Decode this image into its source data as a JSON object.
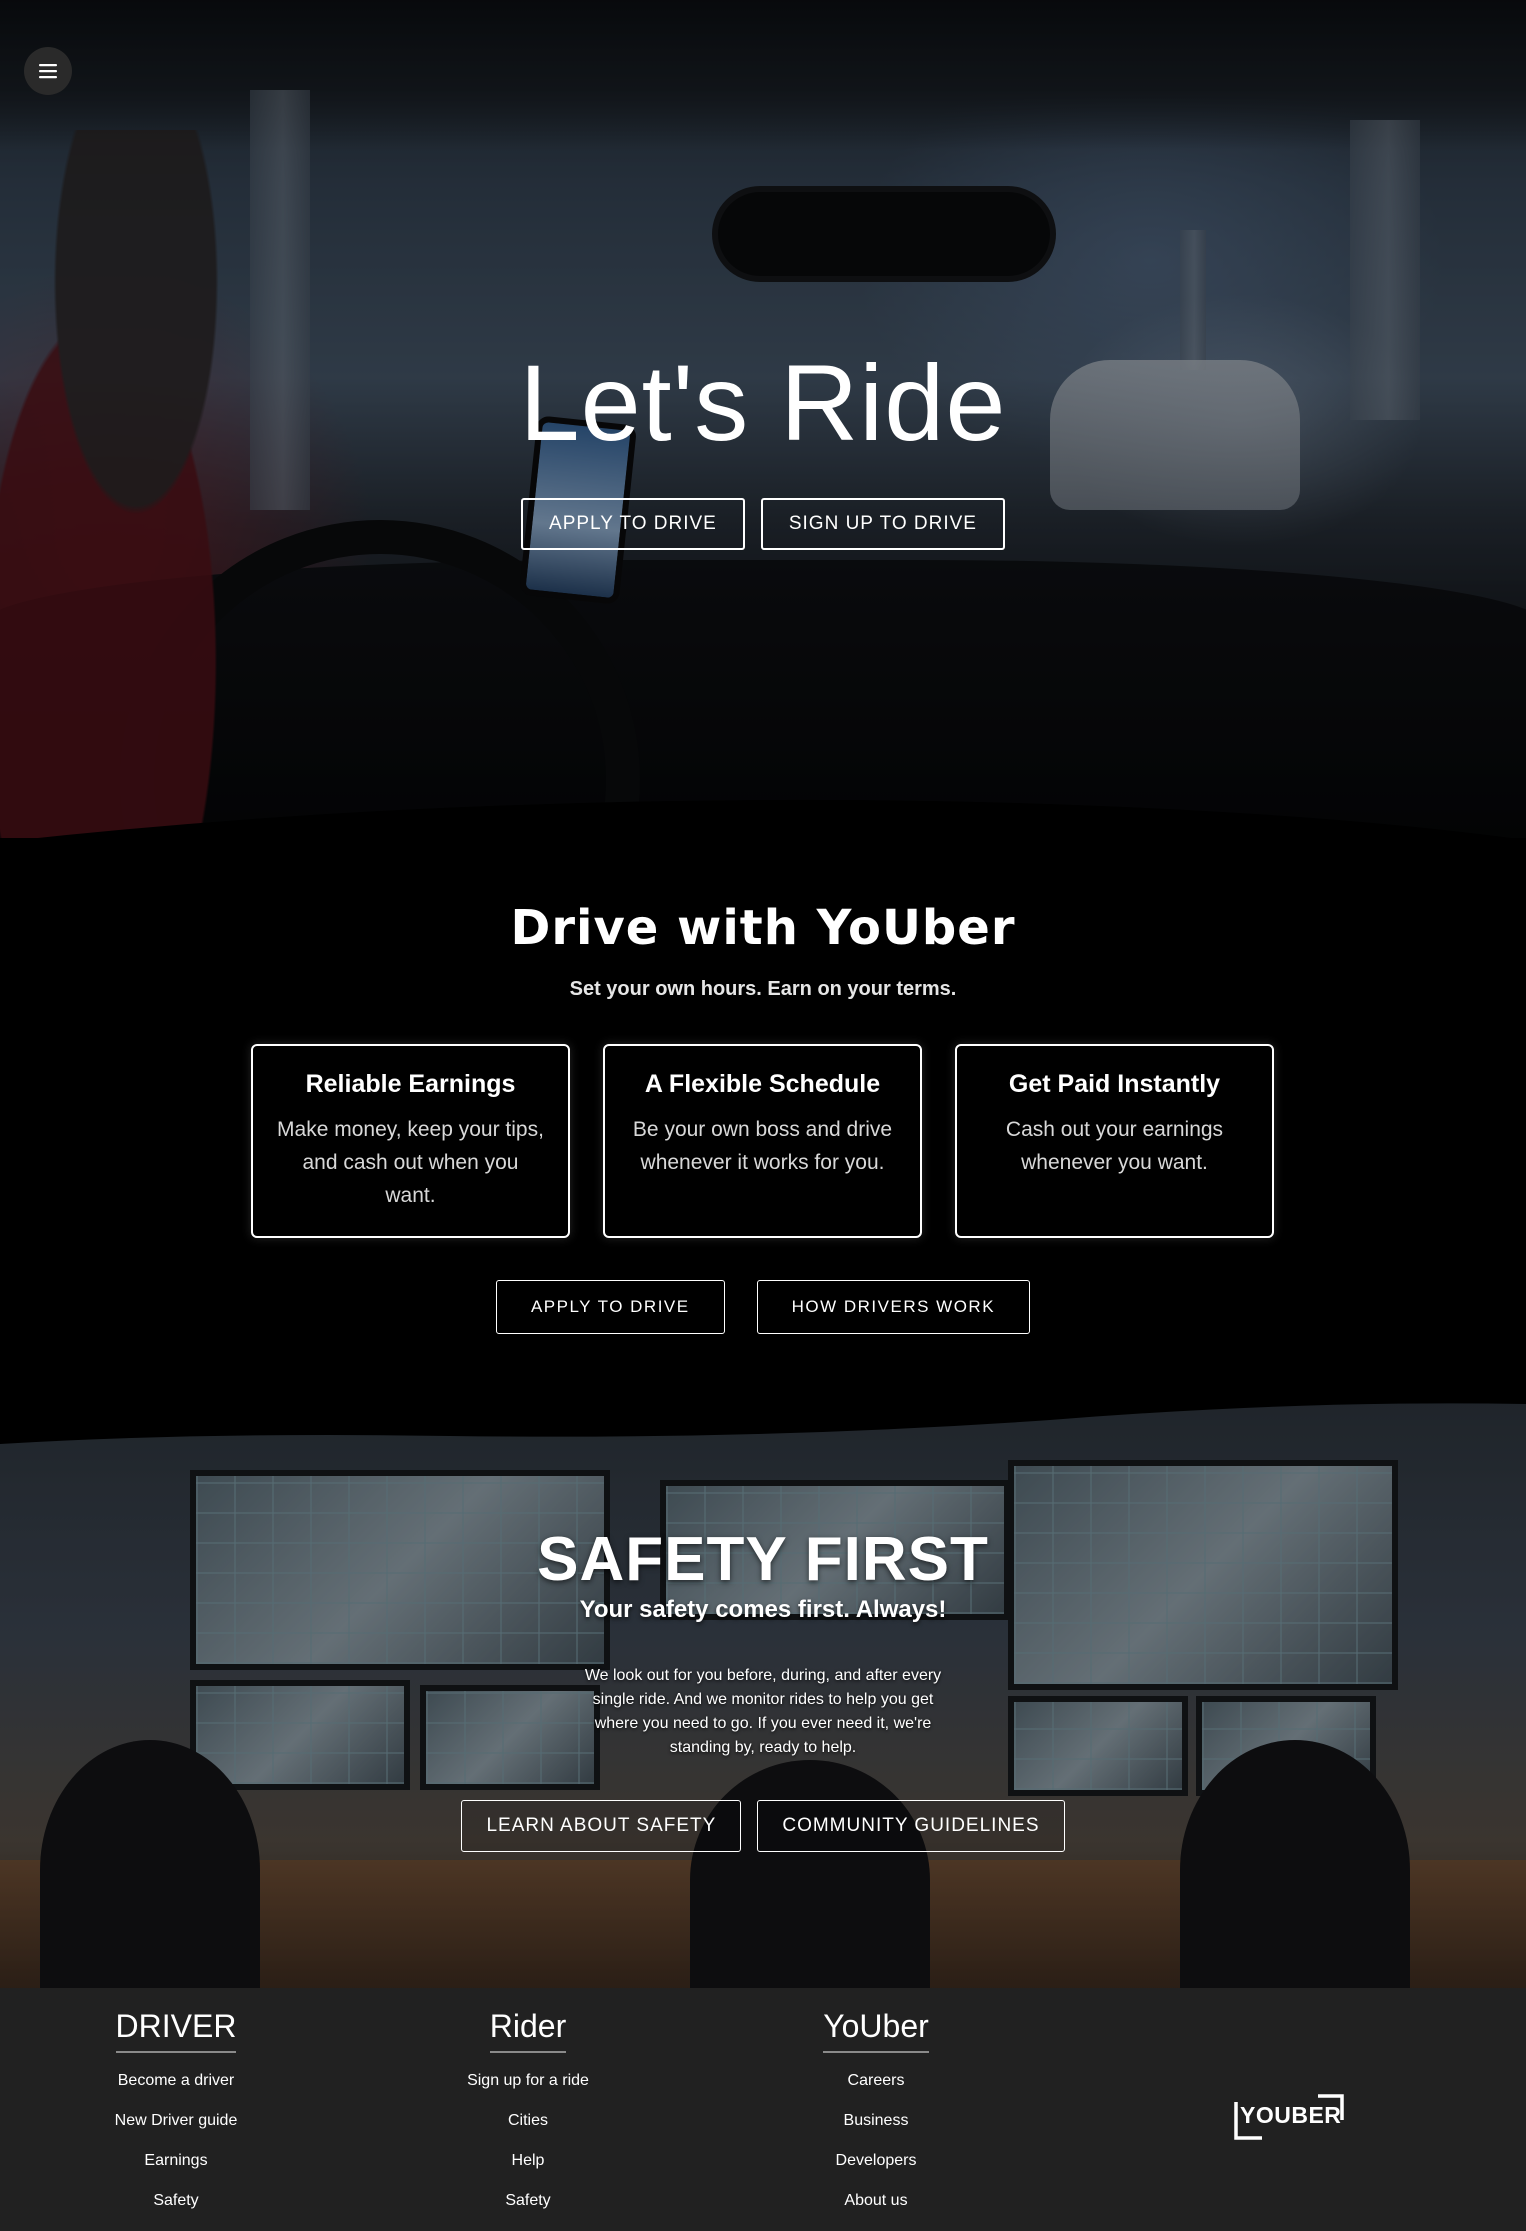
{
  "nav": {
    "menu_icon": "hamburger-menu-icon"
  },
  "hero": {
    "title": "Let's Ride",
    "apply_label": "APPLY TO DRIVE",
    "signup_label": "SIGN UP TO DRIVE"
  },
  "drive": {
    "title": "Drive with YoUber",
    "subtitle": "Set your own hours. Earn on your terms.",
    "cards": [
      {
        "title": "Reliable Earnings",
        "body": "Make money, keep your tips, and cash out when you want."
      },
      {
        "title": "A Flexible Schedule",
        "body": "Be your own boss and drive whenever it works for you."
      },
      {
        "title": "Get Paid Instantly",
        "body": "Cash out your earnings whenever you want."
      }
    ],
    "apply_label": "APPLY TO DRIVE",
    "how_label": "HOW DRIVERS WORK"
  },
  "safety": {
    "title": "SAFETY FIRST",
    "subtitle": "Your safety comes first. Always!",
    "body": "We look out for you before, during, and after every single ride. And we monitor rides to help you get where you need to go. If you ever need it, we're standing by, ready to help.",
    "learn_label": "LEARN ABOUT SAFETY",
    "guidelines_label": "COMMUNITY GUIDELINES"
  },
  "footer": {
    "driver": {
      "heading": "DRIVER",
      "links": [
        "Become a driver",
        "New Driver guide",
        "Earnings",
        "Safety"
      ]
    },
    "rider": {
      "heading": "Rider",
      "links": [
        "Sign up for a ride",
        "Cities",
        "Help",
        "Safety"
      ]
    },
    "youber": {
      "heading": "YoUber",
      "links": [
        "Careers",
        "Business",
        "Developers",
        "About us"
      ]
    },
    "logo_text": "YOUBER"
  }
}
